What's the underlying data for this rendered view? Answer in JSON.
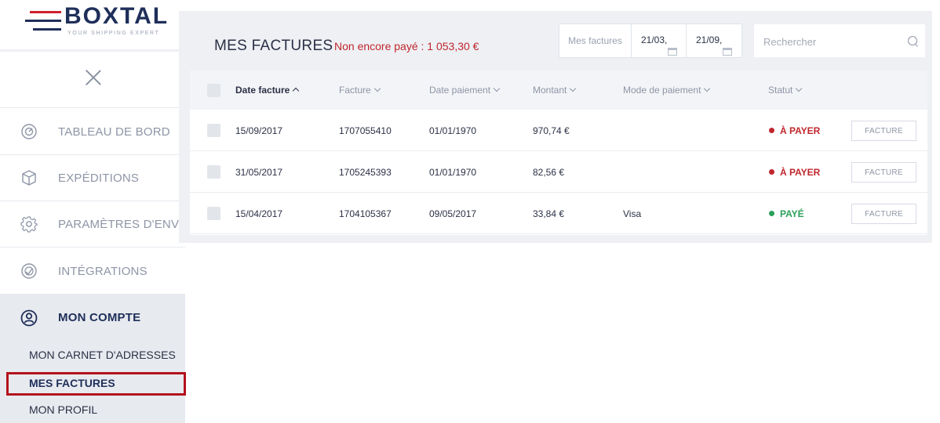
{
  "brand": {
    "name": "BOXTAL",
    "tagline": "YOUR SHIPPING EXPERT"
  },
  "sidebar": {
    "items": [
      {
        "label": "TABLEAU DE BORD",
        "icon": "dashboard-gauge-icon"
      },
      {
        "label": "EXPÉDITIONS",
        "icon": "package-box-icon"
      },
      {
        "label": "PARAMÈTRES D'ENVOI",
        "icon": "gear-icon"
      },
      {
        "label": "INTÉGRATIONS",
        "icon": "integration-icon"
      },
      {
        "label": "MON COMPTE",
        "icon": "user-circle-icon",
        "active": true
      }
    ],
    "subitems": [
      {
        "label": "MON CARNET D'ADRESSES"
      },
      {
        "label": "MES FACTURES",
        "current": true
      },
      {
        "label": "MON PROFIL"
      }
    ]
  },
  "header": {
    "title": "MES FACTURES",
    "unpaid": "Non encore payé : 1 053,30 €"
  },
  "filter": {
    "type_label": "Mes factures",
    "date_from": "21/03,",
    "date_to": "21/09,"
  },
  "search": {
    "placeholder": "Rechercher",
    "value": ""
  },
  "table": {
    "columns": [
      {
        "label": "Date facture",
        "sort": "up",
        "active": true
      },
      {
        "label": "Facture",
        "sort": "down"
      },
      {
        "label": "Date paiement",
        "sort": "down"
      },
      {
        "label": "Montant",
        "sort": "down"
      },
      {
        "label": "Mode de paiement",
        "sort": "down"
      },
      {
        "label": "Statut",
        "sort": "down"
      }
    ],
    "rows": [
      {
        "date": "15/09/2017",
        "invoice": "1707055410",
        "payment_date": "01/01/1970",
        "amount": "970,74 €",
        "method": "",
        "status": "À PAYER",
        "status_color": "#c0262d",
        "button": "FACTURE"
      },
      {
        "date": "31/05/2017",
        "invoice": "1705245393",
        "payment_date": "01/01/1970",
        "amount": "82,56 €",
        "method": "",
        "status": "À PAYER",
        "status_color": "#c0262d",
        "button": "FACTURE"
      },
      {
        "date": "15/04/2017",
        "invoice": "1704105367",
        "payment_date": "09/05/2017",
        "amount": "33,84 €",
        "method": "Visa",
        "status": "PAYÉ",
        "status_color": "#2aa05a",
        "button": "FACTURE"
      }
    ]
  },
  "colors": {
    "accent_red": "#c0262d",
    "paid_green": "#2aa05a",
    "navy": "#1f2f5a"
  }
}
